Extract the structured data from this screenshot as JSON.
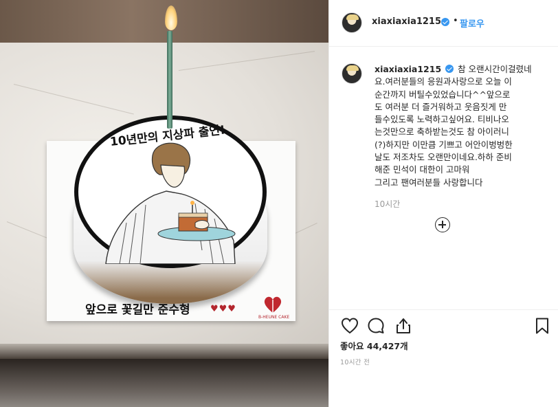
{
  "post": {
    "username": "xiaxiaxia1215",
    "follow_label": "팔로우",
    "separator": "•",
    "caption": "참 오랜시간이걸렸네\n요.여러분들의 응원과사랑으로 오늘 이\n순간까지 버틸수있었습니다^^앞으로\n도 여러분 더 즐거워하고 웃음짓게 만\n들수있도록 노력하고싶어요. 티비나오\n는것만으로 축하받는것도 참 아이러니\n(?)하지만 이만큼 기쁘고 어안이벙벙한\n날도 저조차도 오랜만이네요.하하 준비\n해준 민석이 대한이 고마워\n그리고 팬여러분들 사랑합니다",
    "caption_time": "10시간",
    "likes_label": "좋아요",
    "likes_count": "44,427개",
    "posted_ago": "10시간 전"
  },
  "photo": {
    "cake_title": "10년만의 지상파 출연!",
    "board_text": "앞으로 꽃길만 준수형",
    "hearts": "♥♥♥",
    "bakery_logo": "B-HEUNE CAKE"
  },
  "icons": {
    "like": "heart-icon",
    "comment": "comment-icon",
    "share": "share-icon",
    "save": "bookmark-icon",
    "more_comments": "plus-circle-icon",
    "verified": "verified-badge-icon"
  },
  "colors": {
    "accent": "#3897f0",
    "text": "#262626",
    "muted": "#999999",
    "border": "#efefef"
  }
}
